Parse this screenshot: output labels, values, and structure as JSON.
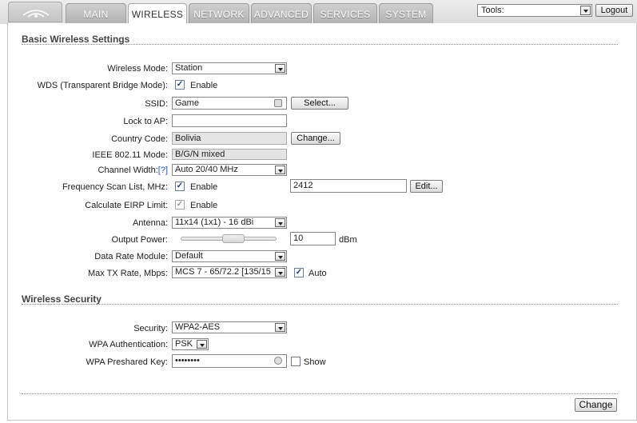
{
  "nav": {
    "tabs": [
      "MAIN",
      "WIRELESS",
      "NETWORK",
      "ADVANCED",
      "SERVICES",
      "SYSTEM"
    ],
    "active_tab": "WIRELESS"
  },
  "header": {
    "tools_label": "Tools:",
    "logout_label": "Logout"
  },
  "basic": {
    "title": "Basic Wireless Settings",
    "wireless_mode_label": "Wireless Mode:",
    "wireless_mode_value": "Station",
    "wds_label": "WDS (Transparent Bridge Mode):",
    "wds_checked": true,
    "enable_label": "Enable",
    "ssid_label": "SSID:",
    "ssid_value": "Game",
    "select_button": "Select...",
    "lock_ap_label": "Lock to AP:",
    "lock_ap_value": "",
    "country_label": "Country Code:",
    "country_value": "Bolivia",
    "change_country_button": "Change...",
    "ieee_label": "IEEE 802.11 Mode:",
    "ieee_value": "B/G/N mixed",
    "channel_width_label": "Channel Width:",
    "channel_width_help": "[?]",
    "channel_width_value": "Auto 20/40 MHz",
    "freq_scan_label": "Frequency Scan List, MHz:",
    "freq_scan_checked": true,
    "freq_scan_value": "2412",
    "edit_button": "Edit...",
    "eirp_label": "Calculate EIRP Limit:",
    "eirp_checked": true,
    "antenna_label": "Antenna:",
    "antenna_value": "11x14 (1x1) - 16 dBi",
    "output_power_label": "Output Power:",
    "output_power_value": "10",
    "output_power_unit": "dBm",
    "output_power_level": 0.57,
    "data_rate_label": "Data Rate Module:",
    "data_rate_value": "Default",
    "max_tx_label": "Max TX Rate, Mbps:",
    "max_tx_value": "MCS 7 - 65/72.2 [135/15",
    "auto_checked": true,
    "auto_label": "Auto"
  },
  "security": {
    "title": "Wireless Security",
    "security_label": "Security:",
    "security_value": "WPA2-AES",
    "wpa_auth_label": "WPA Authentication:",
    "wpa_auth_value": "PSK",
    "wpa_key_label": "WPA Preshared Key:",
    "wpa_key_value": "••••••••",
    "show_checked": false,
    "show_label": "Show"
  },
  "footer": {
    "change_button": "Change"
  }
}
